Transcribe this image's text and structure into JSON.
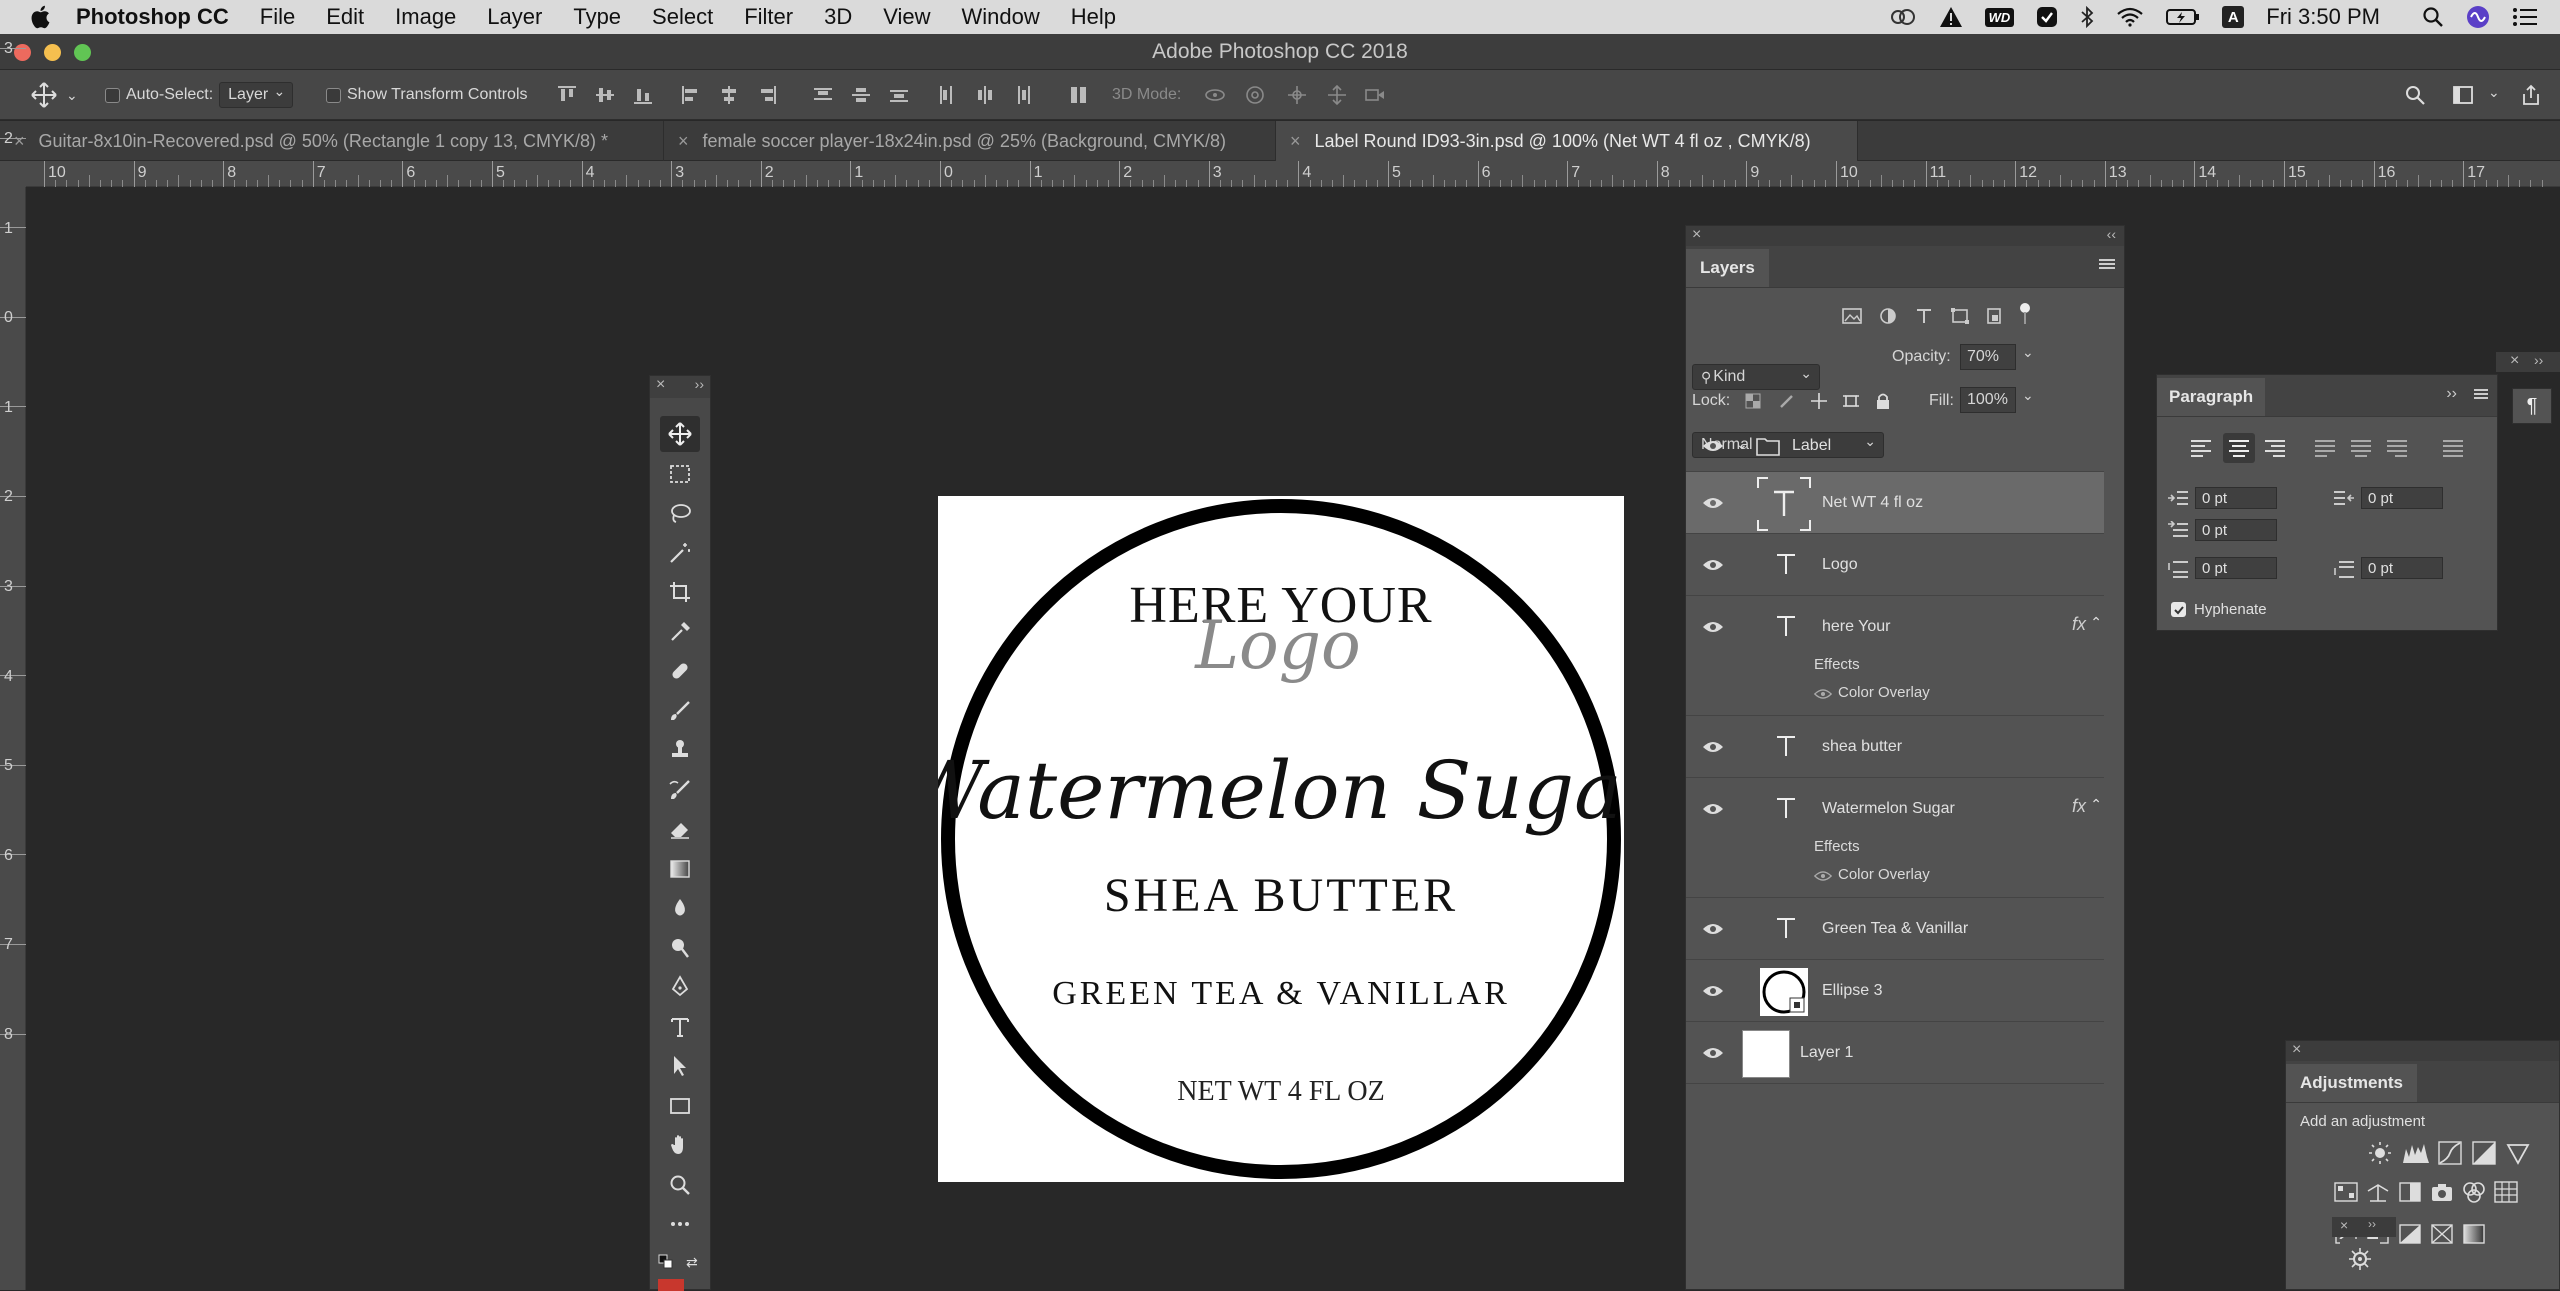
{
  "menubar": {
    "app_name": "Photoshop CC",
    "items": [
      "File",
      "Edit",
      "Image",
      "Layer",
      "Type",
      "Select",
      "Filter",
      "3D",
      "View",
      "Window",
      "Help"
    ],
    "clock": "Fri 3:50 PM",
    "wd_badge": "WD"
  },
  "window": {
    "title": "Adobe Photoshop CC 2018"
  },
  "options": {
    "auto_select_label": "Auto-Select:",
    "auto_select_value": "Layer",
    "transform_label": "Show Transform Controls",
    "mode_3d_label": "3D Mode:"
  },
  "tabs": [
    {
      "label": "Guitar-8x10in-Recovered.psd @ 50% (Rectangle 1 copy 13, CMYK/8) *"
    },
    {
      "label": "female soccer player-18x24in.psd @ 25% (Background, CMYK/8)"
    },
    {
      "label": "Label Round ID93-3in.psd @ 100% (Net WT 4 fl oz , CMYK/8)"
    }
  ],
  "ruler": {
    "h_ticks": [
      "10",
      "9",
      "8",
      "7",
      "6",
      "5",
      "4",
      "3",
      "2",
      "1",
      "0",
      "1",
      "2",
      "3",
      "4",
      "5",
      "6",
      "7",
      "8",
      "9",
      "10",
      "11",
      "12",
      "13",
      "14",
      "15",
      "16",
      "17"
    ],
    "v_ticks": [
      "3",
      "2",
      "1",
      "0",
      "1",
      "2",
      "3",
      "4",
      "5",
      "6",
      "7",
      "8"
    ]
  },
  "label": {
    "here_your": "HERE YOUR",
    "logo": "Logo",
    "product": "Watermelon Sugar",
    "shea": "SHEA BUTTER",
    "scent": "GREEN TEA & VANILLAR",
    "net": "NET WT 4 FL OZ"
  },
  "layers_panel": {
    "tab": "Layers",
    "filter": "Kind",
    "blend_mode": "Normal",
    "opacity_label": "Opacity:",
    "opacity": "70%",
    "lock_label": "Lock:",
    "fill_label": "Fill:",
    "fill": "100%",
    "group": "Label",
    "fx": "fx",
    "effects_label": "Effects",
    "color_overlay": "Color Overlay",
    "layers": [
      "Net WT 4 fl oz",
      "Logo",
      "here Your",
      "shea butter",
      "Watermelon Sugar",
      "Green Tea & Vanillar",
      "Ellipse 3",
      "Layer 1"
    ]
  },
  "paragraph_panel": {
    "tab": "Paragraph",
    "indent_left": "0 pt",
    "indent_right": "0 pt",
    "indent_first": "0 pt",
    "space_before": "0 pt",
    "space_after": "0 pt",
    "hyphenate": "Hyphenate"
  },
  "adjustments_panel": {
    "tab": "Adjustments",
    "subtitle": "Add an adjustment"
  },
  "colors": {
    "ui_dark": "#282828",
    "panel": "#535353",
    "accent_red": "#c8372d"
  }
}
